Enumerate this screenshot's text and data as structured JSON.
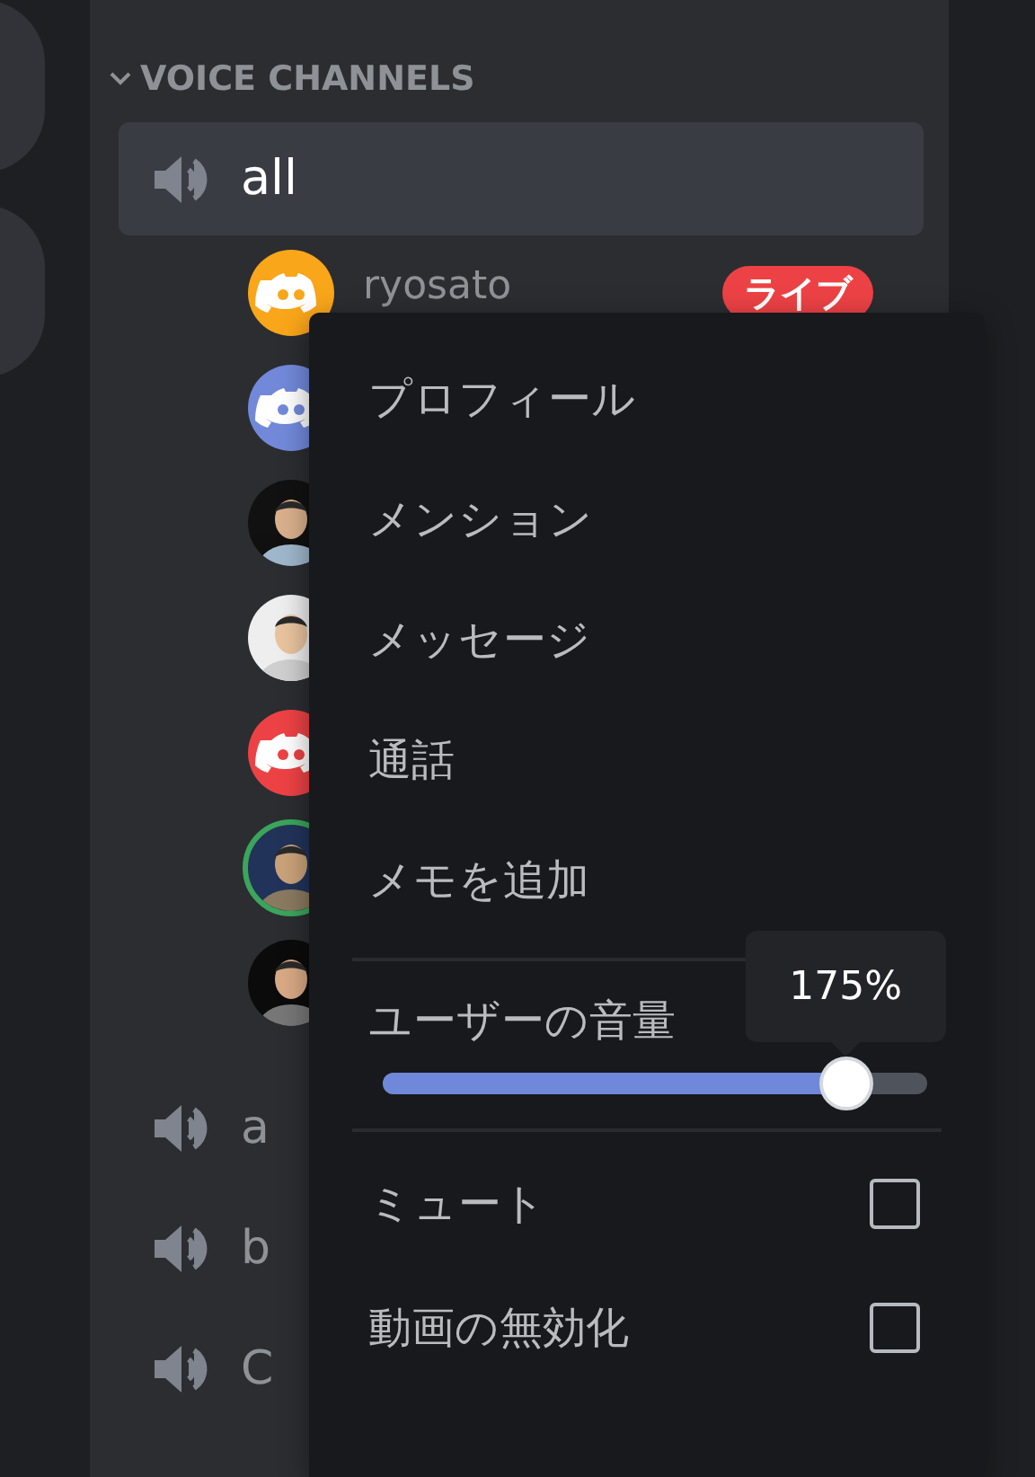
{
  "category": {
    "label": "VOICE CHANNELS",
    "expanded": true
  },
  "active_channel": {
    "name": "all",
    "users": [
      {
        "avatar": {
          "kind": "logo",
          "color": "#faa61a"
        },
        "name": "ryosato",
        "badge": "ライブ",
        "speaking": false
      },
      {
        "avatar": {
          "kind": "logo",
          "color": "#7289da"
        },
        "speaking": false
      },
      {
        "speaking": false
      },
      {
        "speaking": false
      },
      {
        "avatar": {
          "kind": "logo",
          "color": "#ed4245"
        },
        "speaking": false
      },
      {
        "speaking": true
      },
      {
        "speaking": false
      }
    ]
  },
  "channels": [
    {
      "name": "a"
    },
    {
      "name": "b"
    },
    {
      "name": "C"
    }
  ],
  "context_menu": {
    "items": [
      "プロフィール",
      "メンション",
      "メッセージ",
      "通話",
      "メモを追加"
    ],
    "volume": {
      "label": "ユーザーの音量",
      "level": 0.85,
      "tooltip": "175%"
    },
    "toggles": [
      {
        "label": "ミュート",
        "checked": false
      },
      {
        "label": "動画の無効化",
        "checked": false
      }
    ]
  }
}
